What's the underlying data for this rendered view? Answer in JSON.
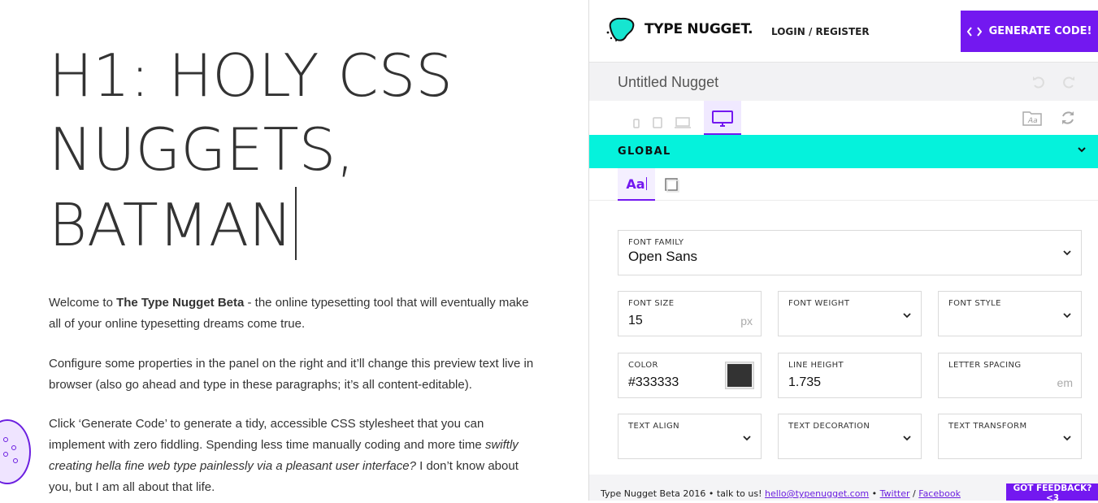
{
  "preview": {
    "heading_lines": [
      "H1: HOLY CSS",
      "NUGGETS,",
      "BATMAN"
    ],
    "p1": {
      "before": "Welcome to ",
      "bold": "The Type Nugget Beta",
      "after": " - the online typesetting tool that will eventually make all of your online typesetting dreams come true."
    },
    "p2": "Configure some properties in the panel on the right and it’ll change this preview text live in browser (also go ahead and type in these paragraphs; it’s all content-editable).",
    "p3": {
      "before": "Click ‘Generate Code’ to generate a tidy, accessible CSS stylesheet that you can implement with zero fiddling. Spending less time manually coding and more time ",
      "italic": "swiftly creating hella fine web type painlessly via a pleasant user interface?",
      "after": " I don’t know about you, but I am all about that life."
    }
  },
  "header": {
    "logo_text": "TYPE NUGGET.",
    "login": "LOGIN",
    "separator": "/",
    "register": "REGISTER",
    "generate_label": "GENERATE CODE!"
  },
  "nugget": {
    "name": "Untitled Nugget"
  },
  "devices": [
    "mobile-portrait",
    "tablet",
    "laptop",
    "desktop"
  ],
  "section": {
    "title": "GLOBAL"
  },
  "subtabs": {
    "typography": "Aa"
  },
  "fields": {
    "font_family": {
      "label": "FONT FAMILY",
      "value": "Open Sans"
    },
    "font_size": {
      "label": "FONT SIZE",
      "value": "15",
      "unit": "px"
    },
    "font_weight": {
      "label": "FONT WEIGHT",
      "value": ""
    },
    "font_style": {
      "label": "FONT STYLE",
      "value": ""
    },
    "color": {
      "label": "COLOR",
      "value": "#333333"
    },
    "line_height": {
      "label": "LINE HEIGHT",
      "value": "1.735"
    },
    "letter_spacing": {
      "label": "LETTER SPACING",
      "value": "",
      "unit": "em"
    },
    "text_align": {
      "label": "TEXT ALIGN",
      "value": ""
    },
    "text_decoration": {
      "label": "TEXT DECORATION",
      "value": ""
    },
    "text_transform": {
      "label": "TEXT TRANSFORM",
      "value": ""
    }
  },
  "footer": {
    "version": "Type Nugget Beta 2016",
    "bullet": "•",
    "talk": "talk to us!",
    "email": "hello@typenugget.com",
    "twitter": "Twitter",
    "slash": "/",
    "facebook": "Facebook",
    "feedback": "GOT FEEDBACK? <3"
  },
  "colors": {
    "accent": "#7318f0",
    "cyan": "#05f2dc",
    "text": "#333333"
  }
}
